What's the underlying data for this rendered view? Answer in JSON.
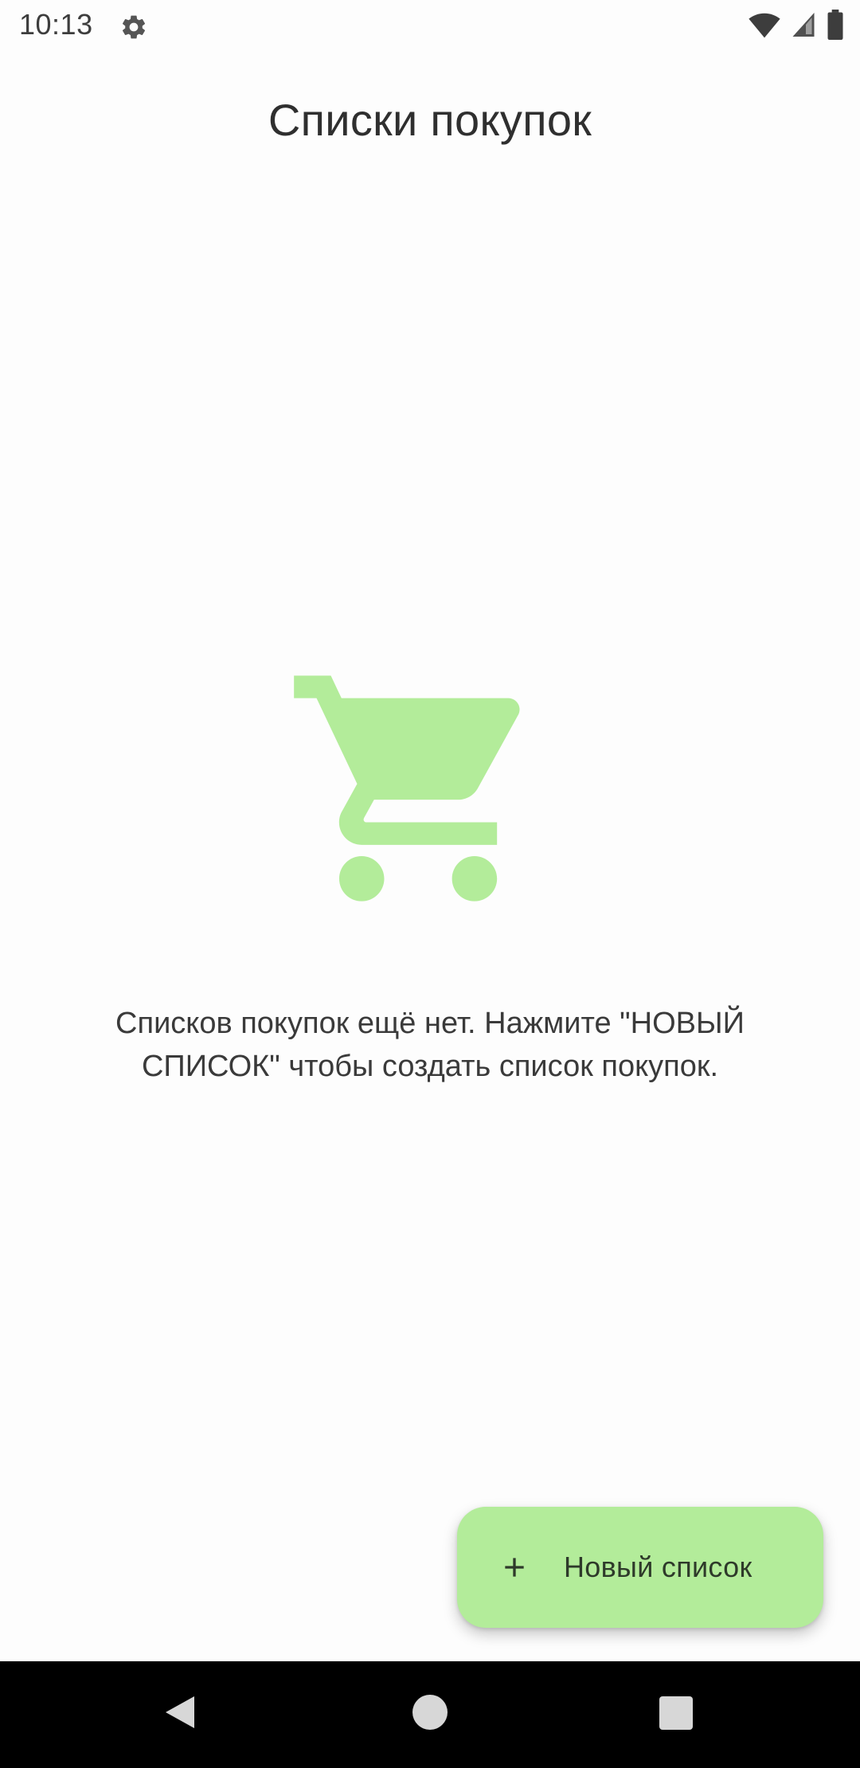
{
  "status_bar": {
    "time": "10:13",
    "settings_icon": "gear-icon",
    "wifi_icon": "wifi-icon",
    "signal_icon": "signal-icon",
    "battery_icon": "battery-icon"
  },
  "header": {
    "title": "Списки покупок"
  },
  "empty_state": {
    "icon": "shopping-cart-icon",
    "icon_color": "#b3ec9a",
    "message": "Списков покупок ещё нет. Нажмите \"НОВЫЙ СПИСОК\" чтобы создать список покупок."
  },
  "fab": {
    "icon": "plus-icon",
    "label": "Новый список",
    "color": "#b3ec9a"
  },
  "nav_bar": {
    "back_icon": "back-triangle-icon",
    "home_icon": "home-circle-icon",
    "recents_icon": "recents-square-icon"
  }
}
